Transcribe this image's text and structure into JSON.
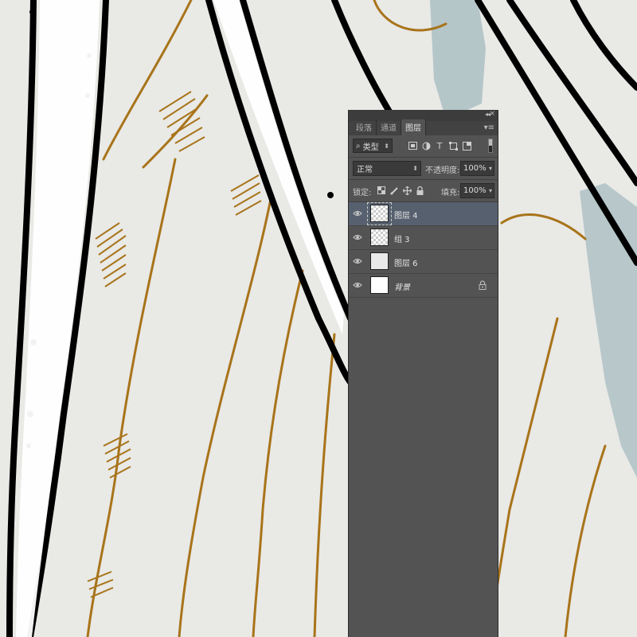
{
  "panel": {
    "tabs": [
      {
        "label": "段落",
        "active": false
      },
      {
        "label": "通道",
        "active": false
      },
      {
        "label": "图层",
        "active": true
      }
    ],
    "filter_kind": "类型",
    "filter_icons": [
      "image-filter-icon",
      "adjustment-filter-icon",
      "text-filter-icon",
      "shape-filter-icon",
      "smart-object-filter-icon"
    ],
    "blend_mode": "正常",
    "opacity_label": "不透明度:",
    "opacity_value": "100%",
    "lock_label": "锁定:",
    "fill_label": "填充:",
    "fill_value": "100%",
    "layers": [
      {
        "name": "图层 4",
        "visible": true,
        "selected": true,
        "thumb": "checker",
        "locked": false,
        "italic": false
      },
      {
        "name": "组 3",
        "visible": true,
        "selected": false,
        "thumb": "checker",
        "locked": false,
        "italic": false
      },
      {
        "name": "图层 6",
        "visible": true,
        "selected": false,
        "thumb": "light",
        "locked": false,
        "italic": false
      },
      {
        "name": "背景",
        "visible": true,
        "selected": false,
        "thumb": "white",
        "locked": true,
        "italic": true
      }
    ]
  },
  "colors": {
    "panel_bg": "#535353",
    "selected_row": "#56606e",
    "canvas_bg": "#e9e9e6",
    "gold_stroke": "#a8741a",
    "blue_wash": "#b5c6c9",
    "ink": "#000000"
  }
}
